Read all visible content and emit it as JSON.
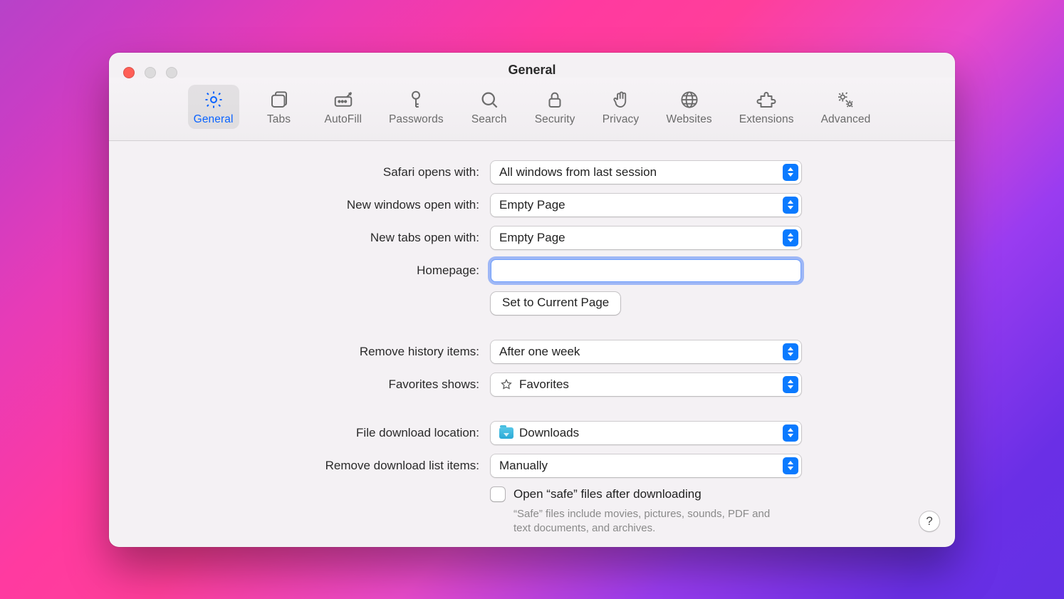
{
  "window": {
    "title": "General"
  },
  "toolbar": {
    "items": [
      {
        "label": "General",
        "selected": true
      },
      {
        "label": "Tabs",
        "selected": false
      },
      {
        "label": "AutoFill",
        "selected": false
      },
      {
        "label": "Passwords",
        "selected": false
      },
      {
        "label": "Search",
        "selected": false
      },
      {
        "label": "Security",
        "selected": false
      },
      {
        "label": "Privacy",
        "selected": false
      },
      {
        "label": "Websites",
        "selected": false
      },
      {
        "label": "Extensions",
        "selected": false
      },
      {
        "label": "Advanced",
        "selected": false
      }
    ]
  },
  "form": {
    "safari_opens_with": {
      "label": "Safari opens with:",
      "value": "All windows from last session"
    },
    "new_windows_open_with": {
      "label": "New windows open with:",
      "value": "Empty Page"
    },
    "new_tabs_open_with": {
      "label": "New tabs open with:",
      "value": "Empty Page"
    },
    "homepage": {
      "label": "Homepage:",
      "value": ""
    },
    "set_to_current_page": {
      "label": "Set to Current Page"
    },
    "remove_history_items": {
      "label": "Remove history items:",
      "value": "After one week"
    },
    "favorites_shows": {
      "label": "Favorites shows:",
      "value": "Favorites"
    },
    "file_download_location": {
      "label": "File download location:",
      "value": "Downloads"
    },
    "remove_download_list": {
      "label": "Remove download list items:",
      "value": "Manually"
    },
    "open_safe_files": {
      "label": "Open “safe” files after downloading",
      "checked": false,
      "help": "“Safe” files include movies, pictures, sounds, PDF and text documents, and archives."
    }
  },
  "help_button": "?"
}
